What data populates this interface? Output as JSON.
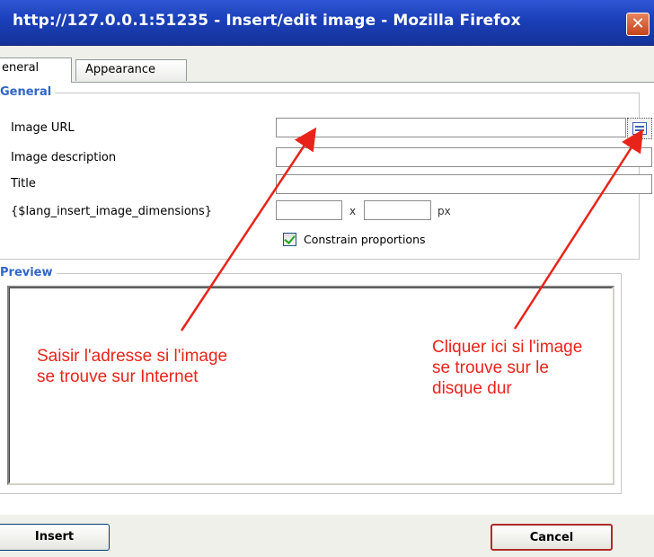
{
  "window": {
    "title": "http://127.0.0.1:51235 - Insert/edit image - Mozilla Firefox",
    "close_glyph": "✕"
  },
  "tabs": [
    {
      "label": "eneral",
      "active": true
    },
    {
      "label": "Appearance",
      "active": false
    }
  ],
  "general": {
    "legend": "General",
    "fields": {
      "image_url": {
        "label": "Image URL",
        "value": ""
      },
      "image_description": {
        "label": "Image description",
        "value": ""
      },
      "title": {
        "label": "Title",
        "value": ""
      },
      "dimensions": {
        "label": "{$lang_insert_image_dimensions}",
        "width": "",
        "height": "",
        "separator": "x",
        "unit": "px"
      }
    },
    "constrain": {
      "label": "Constrain proportions",
      "checked": true
    },
    "browse_icon": "browse-icon"
  },
  "preview": {
    "legend": "Preview"
  },
  "annotations": {
    "left": "Saisir l'adresse si l'image\nse trouve sur Internet",
    "right": "Cliquer ici si l'image\nse trouve sur le\ndisque dur",
    "color": "#e8241a"
  },
  "buttons": {
    "insert": "Insert",
    "cancel": "Cancel"
  }
}
